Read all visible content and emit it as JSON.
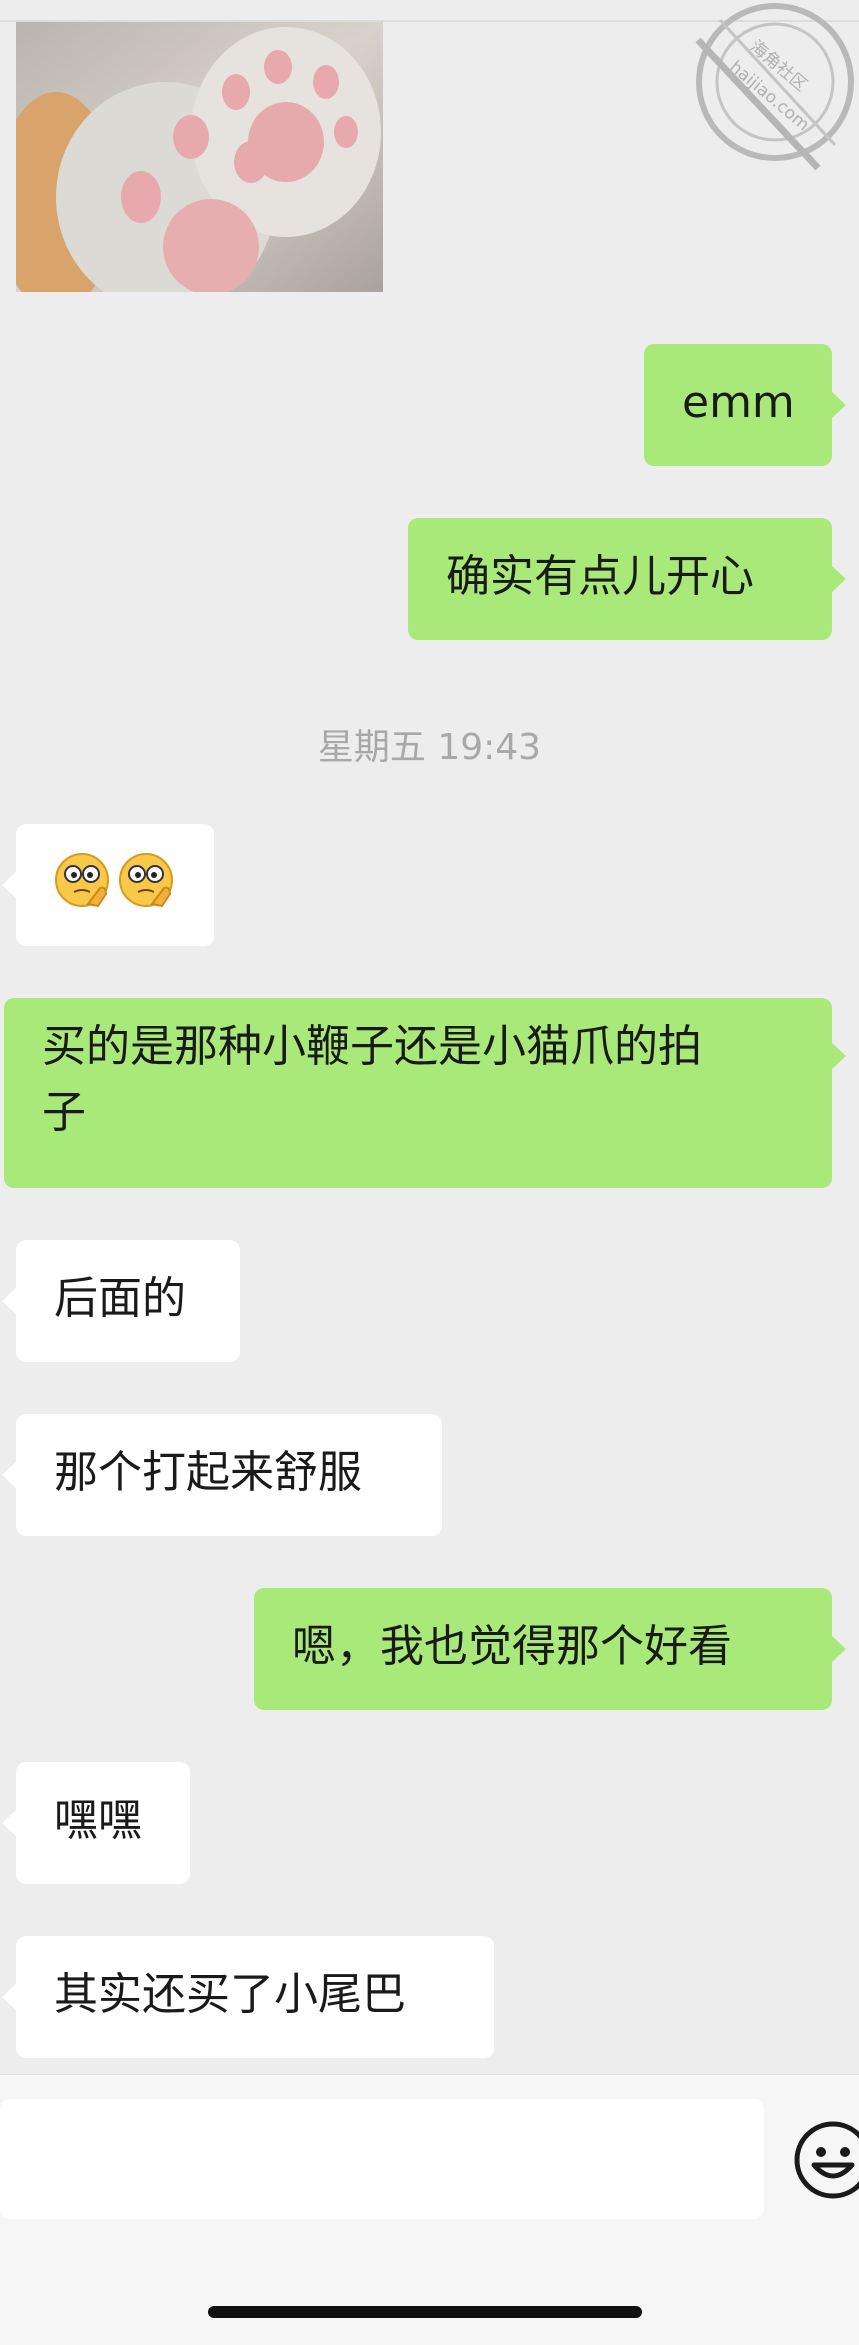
{
  "watermark": {
    "line1": "海角社区",
    "line2": "haijiao.com"
  },
  "messages": [
    {
      "id": "m1",
      "side": "out",
      "text": "emm"
    },
    {
      "id": "m2",
      "side": "out",
      "text": "确实有点儿开心"
    },
    {
      "id": "m3",
      "side": "in",
      "type": "emoji",
      "emoji_names": [
        "thinking-face-emoji",
        "thinking-face-emoji"
      ]
    },
    {
      "id": "m4",
      "side": "out",
      "text_line1": "买的是那种小鞭子还是小猫爪的拍",
      "text_line2": "子"
    },
    {
      "id": "m5",
      "side": "in",
      "text": "后面的"
    },
    {
      "id": "m6",
      "side": "in",
      "text": "那个打起来舒服"
    },
    {
      "id": "m7",
      "side": "out",
      "text": "嗯，我也觉得那个好看"
    },
    {
      "id": "m8",
      "side": "in",
      "text": "嘿嘿"
    },
    {
      "id": "m9",
      "side": "in",
      "text": "其实还买了小尾巴"
    }
  ],
  "timestamp": "星期五 19:43",
  "input": {
    "value": "",
    "emoji_icon": "smiley-face-icon"
  },
  "colors": {
    "background": "#ededed",
    "outgoing_bubble": "#a9e97a",
    "incoming_bubble": "#ffffff",
    "timestamp_text": "#a8a8a8"
  }
}
